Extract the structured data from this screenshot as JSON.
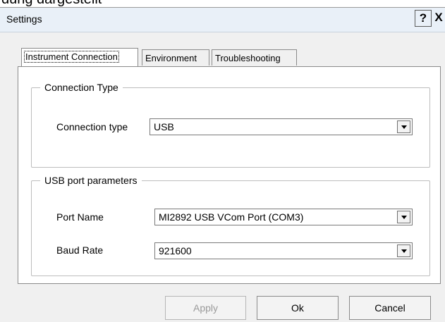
{
  "background_text": "dung dargestellt",
  "window": {
    "title": "Settings"
  },
  "titlebar_buttons": {
    "help": "?",
    "close": "X"
  },
  "tabs": [
    "Instrument Connection",
    "Environment",
    "Troubleshooting"
  ],
  "connection_group": {
    "title": "Connection Type",
    "label": "Connection type",
    "value": "USB"
  },
  "usb_group": {
    "title": "USB port parameters",
    "port_label": "Port Name",
    "port_value": "MI2892 USB VCom Port (COM3)",
    "baud_label": "Baud Rate",
    "baud_value": "921600"
  },
  "buttons": {
    "apply": "Apply",
    "ok": "Ok",
    "cancel": "Cancel"
  },
  "colors": {
    "titlebar": "#e9f0f8",
    "dialog": "#f0f0f0",
    "panel": "#ffffff",
    "disabled_text": "#9a9a9a"
  },
  "icons": {
    "combo_arrow": "chevron-down-icon"
  }
}
